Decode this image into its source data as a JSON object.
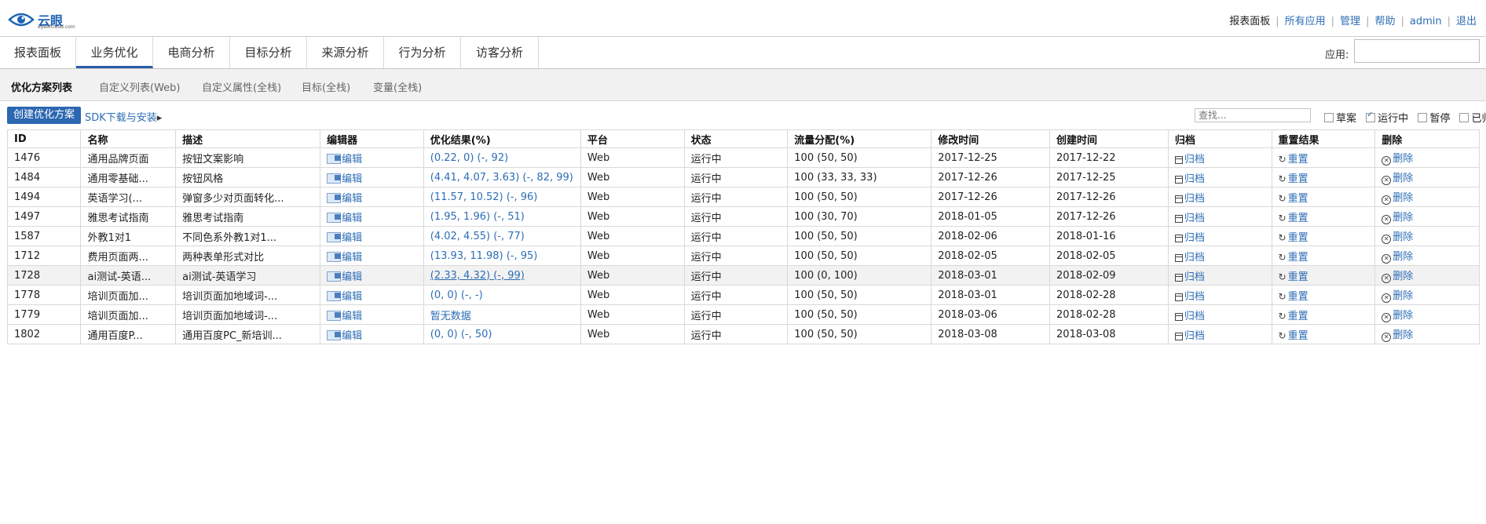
{
  "header": {
    "brand": "云眼",
    "brand_sub": "eyeofcloud.com",
    "links": [
      "报表面板",
      "所有应用",
      "管理",
      "帮助",
      "admin",
      "退出"
    ]
  },
  "nav": {
    "tabs": [
      "报表面板",
      "业务优化",
      "电商分析",
      "目标分析",
      "来源分析",
      "行为分析",
      "访客分析"
    ],
    "active": "业务优化",
    "app_label": "应用:",
    "app_value": ""
  },
  "subnav": {
    "tabs": [
      "优化方案列表",
      "自定义列表(Web)",
      "自定义属性(全栈)",
      "目标(全栈)",
      "变量(全栈)"
    ],
    "active": "优化方案列表"
  },
  "toolbar": {
    "create_label": "创建优化方案",
    "sdk_label": "SDK下载与安装",
    "sdk_arrow": "▸",
    "search_placeholder": "查找...",
    "filters": [
      {
        "label": "草案",
        "checked": false
      },
      {
        "label": "运行中",
        "checked": true
      },
      {
        "label": "暂停",
        "checked": false
      },
      {
        "label": "已归档",
        "checked": false
      }
    ]
  },
  "table": {
    "headers": [
      "ID",
      "名称",
      "描述",
      "编辑器",
      "优化结果(%)",
      "平台",
      "状态",
      "流量分配(%)",
      "修改时间",
      "创建时间",
      "归档",
      "重置结果",
      "删除"
    ],
    "edit_label": "编辑",
    "archive_label": "归档",
    "reset_label": "重置",
    "delete_label": "删除",
    "rows": [
      {
        "id": "1476",
        "name": "通用品牌页面",
        "desc": "按钮文案影响",
        "result": "(0.22, 0) (-, 92)",
        "platform": "Web",
        "status": "运行中",
        "traffic": "100 (50, 50)",
        "modified": "2017-12-25",
        "created": "2017-12-22"
      },
      {
        "id": "1484",
        "name": "通用零基础...",
        "desc": "按钮风格",
        "result": "(4.41, 4.07, 3.63) (-, 82, 99)",
        "platform": "Web",
        "status": "运行中",
        "traffic": "100 (33, 33, 33)",
        "modified": "2017-12-26",
        "created": "2017-12-25"
      },
      {
        "id": "1494",
        "name": "英语学习(...",
        "desc": "弹窗多少对页面转化...",
        "result": "(11.57, 10.52) (-, 96)",
        "platform": "Web",
        "status": "运行中",
        "traffic": "100 (50, 50)",
        "modified": "2017-12-26",
        "created": "2017-12-26"
      },
      {
        "id": "1497",
        "name": "雅思考试指南",
        "desc": "雅思考试指南",
        "result": "(1.95, 1.96) (-, 51)",
        "platform": "Web",
        "status": "运行中",
        "traffic": "100 (30, 70)",
        "modified": "2018-01-05",
        "created": "2017-12-26"
      },
      {
        "id": "1587",
        "name": "外教1对1",
        "desc": "不同色系外教1对1...",
        "result": "(4.02, 4.55) (-, 77)",
        "platform": "Web",
        "status": "运行中",
        "traffic": "100 (50, 50)",
        "modified": "2018-02-06",
        "created": "2018-01-16"
      },
      {
        "id": "1712",
        "name": "费用页面两...",
        "desc": "两种表单形式对比",
        "result": "(13.93, 11.98) (-, 95)",
        "platform": "Web",
        "status": "运行中",
        "traffic": "100 (50, 50)",
        "modified": "2018-02-05",
        "created": "2018-02-05"
      },
      {
        "id": "1728",
        "name": "ai测试-英语...",
        "desc": "ai测试-英语学习",
        "result": "(2.33, 4.32) (-, 99)",
        "platform": "Web",
        "status": "运行中",
        "traffic": "100 (0, 100)",
        "modified": "2018-03-01",
        "created": "2018-02-09",
        "highlight": true
      },
      {
        "id": "1778",
        "name": "培训页面加...",
        "desc": "培训页面加地域词-...",
        "result": "(0, 0) (-, -)",
        "platform": "Web",
        "status": "运行中",
        "traffic": "100 (50, 50)",
        "modified": "2018-03-01",
        "created": "2018-02-28"
      },
      {
        "id": "1779",
        "name": "培训页面加...",
        "desc": "培训页面加地域词-...",
        "result": "暂无数据",
        "platform": "Web",
        "status": "运行中",
        "traffic": "100 (50, 50)",
        "modified": "2018-03-06",
        "created": "2018-02-28"
      },
      {
        "id": "1802",
        "name": "通用百度P...",
        "desc": "通用百度PC_新培训...",
        "result": "(0, 0) (-, 50)",
        "platform": "Web",
        "status": "运行中",
        "traffic": "100 (50, 50)",
        "modified": "2018-03-08",
        "created": "2018-03-08"
      }
    ]
  }
}
